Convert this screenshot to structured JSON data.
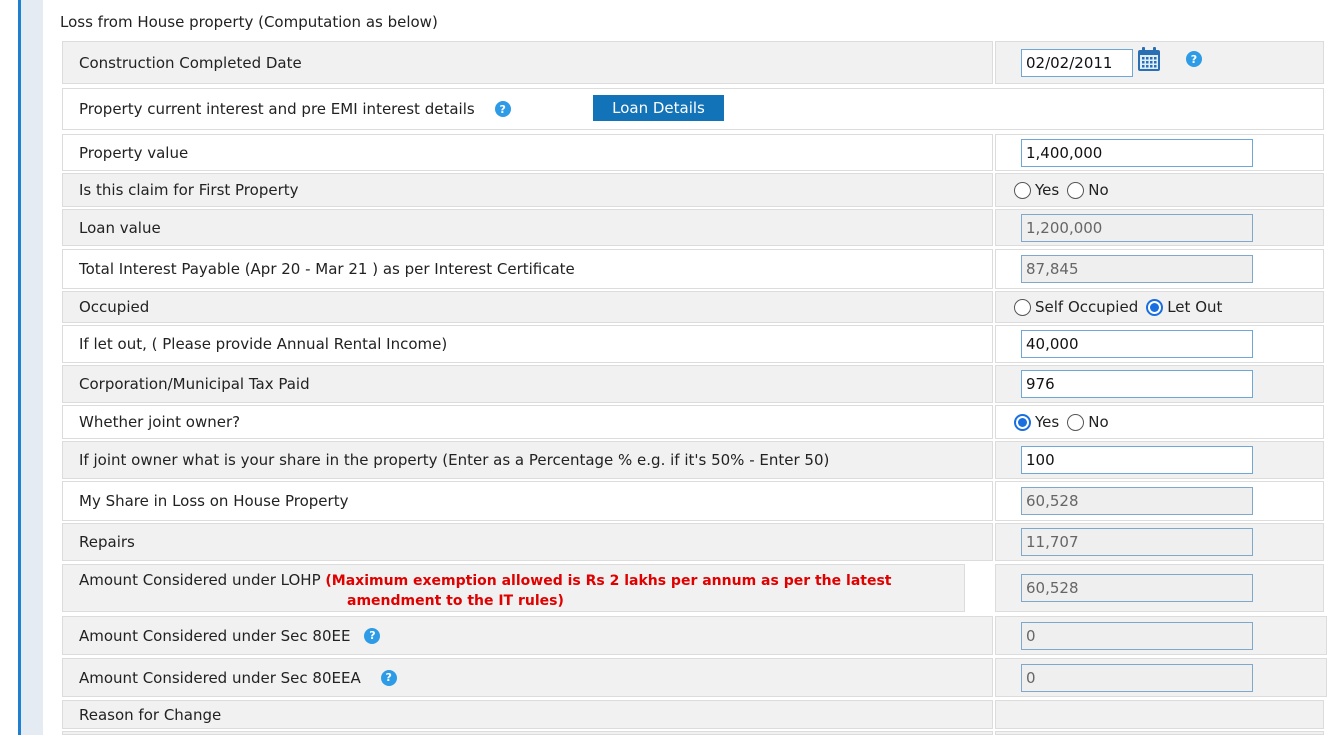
{
  "section_title": "Loss from House property (Computation as below)",
  "rows": {
    "construction": {
      "label": "Construction Completed Date",
      "value": "02/02/2011"
    },
    "interest_details": {
      "label": "Property current interest and pre EMI interest details",
      "button": "Loan Details"
    },
    "property_value": {
      "label": "Property value",
      "value": "1,400,000"
    },
    "first_property": {
      "label": "Is this claim for First Property",
      "opt_yes": "Yes",
      "opt_no": "No"
    },
    "loan_value": {
      "label": "Loan value",
      "value": "1,200,000"
    },
    "total_interest": {
      "label": "Total Interest Payable (Apr 20  - Mar 21  ) as per Interest Certificate",
      "value": "87,845"
    },
    "occupied": {
      "label": "Occupied",
      "opt_self": "Self Occupied",
      "opt_let": "Let Out",
      "selected": "Let Out"
    },
    "rental_income": {
      "label": "If let out, ( Please provide Annual Rental Income)",
      "value": "40,000"
    },
    "municipal_tax": {
      "label": "Corporation/Municipal Tax Paid",
      "value": "976"
    },
    "joint_owner": {
      "label": "Whether joint owner?",
      "opt_yes": "Yes",
      "opt_no": "No",
      "selected": "Yes"
    },
    "share_percent": {
      "label": "If joint owner what is your share in the property (Enter as a Percentage % e.g. if it's 50% - Enter 50)",
      "value": "100"
    },
    "my_share_loss": {
      "label": "My Share in Loss on House Property",
      "value": "60,528"
    },
    "repairs": {
      "label": "Repairs",
      "value": "11,707"
    },
    "lohp": {
      "label": "Amount Considered under LOHP",
      "note_line1": "(Maximum exemption allowed is Rs 2 lakhs per annum as per the latest",
      "note_line2": "amendment to the IT rules)",
      "value": "60,528"
    },
    "sec80ee": {
      "label": "Amount Considered under Sec 80EE",
      "value": "0"
    },
    "sec80eea": {
      "label": "Amount Considered under Sec 80EEA",
      "value": "0"
    },
    "reason": {
      "label": "Reason for Change"
    }
  },
  "colors": {
    "accent": "#1273b8",
    "help_icon": "#2e9be6",
    "note_red": "#e00000",
    "row_grey": "#f1f1f1",
    "left_bar": "#1f7fd1"
  },
  "icons": {
    "help": "?",
    "calendar": "calendar-icon"
  }
}
